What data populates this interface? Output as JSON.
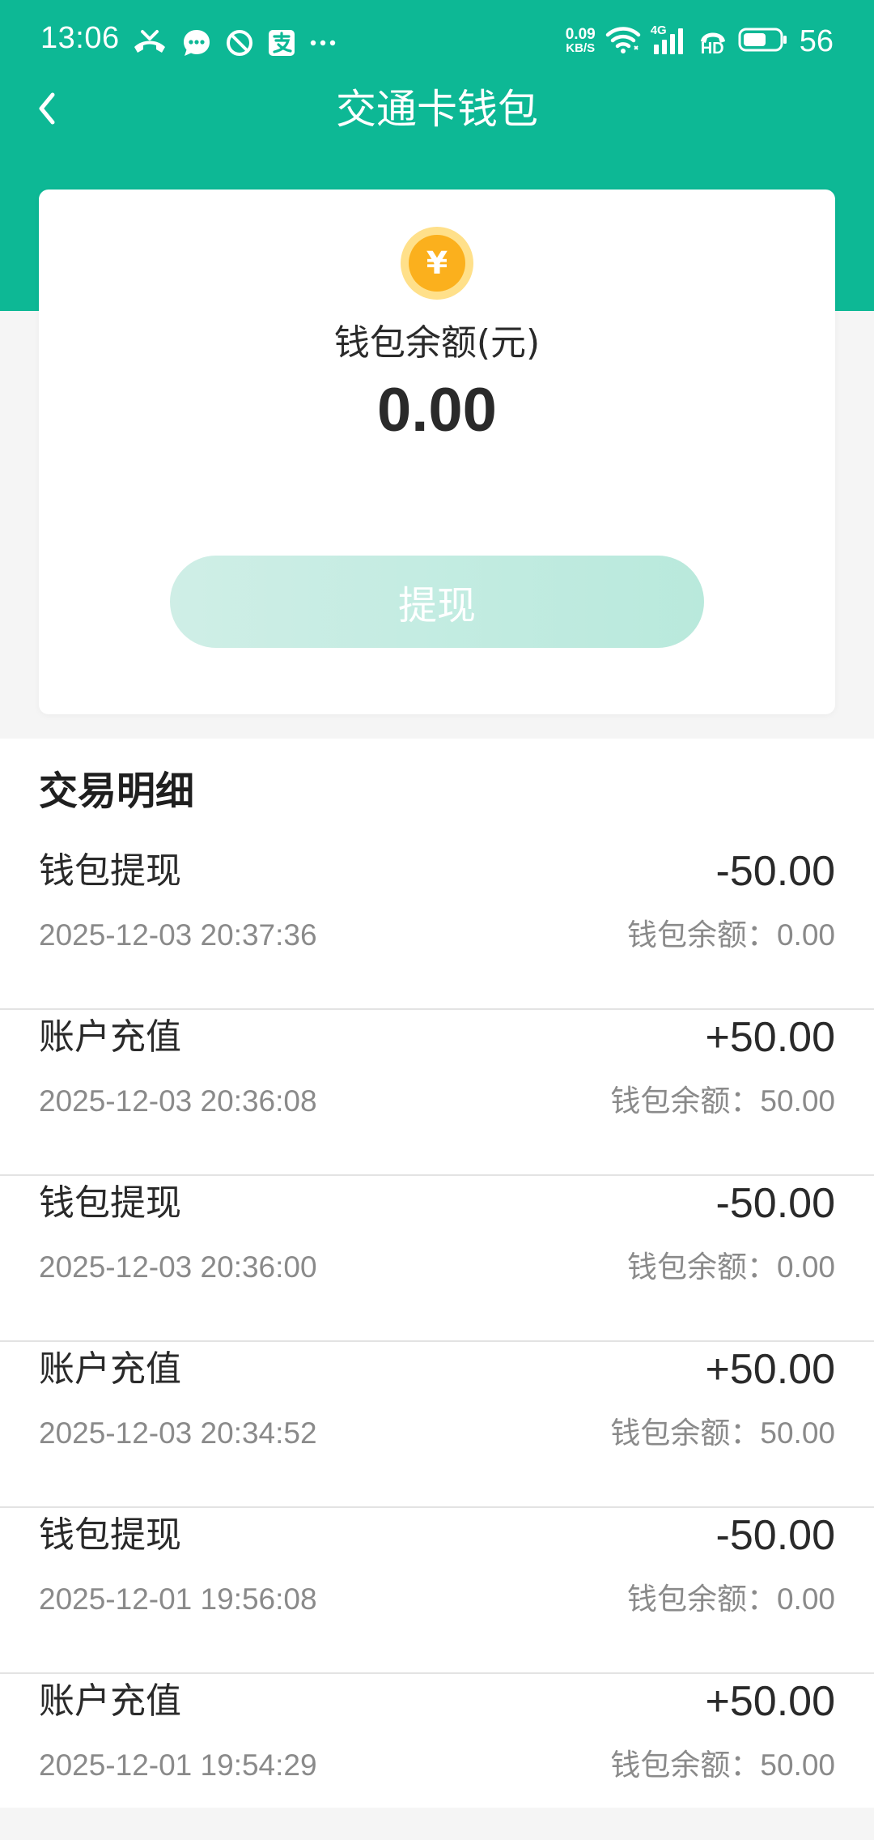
{
  "status_bar": {
    "time": "13:06",
    "net_speed_value": "0.09",
    "net_speed_unit": "KB/S",
    "network_type": "4G",
    "hd_label": "HD",
    "battery_level": "56",
    "icons": [
      "missed-call-icon",
      "message-bubble-icon",
      "do-not-disturb-icon",
      "alipay-icon",
      "more-dots-icon",
      "wifi-icon",
      "signal-icon",
      "hd-call-icon",
      "battery-icon"
    ],
    "color": "#ffffff"
  },
  "header": {
    "title": "交通卡钱包",
    "back_icon": "chevron-left-icon",
    "background_color": "#0db895"
  },
  "wallet": {
    "balance_label": "钱包余额(元)",
    "balance_value": "0.00",
    "coin_symbol": "¥",
    "withdraw_label": "提现"
  },
  "transactions": {
    "title": "交易明细",
    "balance_prefix": "钱包余额：",
    "items": [
      {
        "title": "钱包提现",
        "time": "2025-12-03 20:37:36",
        "amount": "-50.00",
        "balance": "0.00"
      },
      {
        "title": "账户充值",
        "time": "2025-12-03 20:36:08",
        "amount": "+50.00",
        "balance": "50.00"
      },
      {
        "title": "钱包提现",
        "time": "2025-12-03 20:36:00",
        "amount": "-50.00",
        "balance": "0.00"
      },
      {
        "title": "账户充值",
        "time": "2025-12-03 20:34:52",
        "amount": "+50.00",
        "balance": "50.00"
      },
      {
        "title": "钱包提现",
        "time": "2025-12-01 19:56:08",
        "amount": "-50.00",
        "balance": "0.00"
      },
      {
        "title": "账户充值",
        "time": "2025-12-01 19:54:29",
        "amount": "+50.00",
        "balance": "50.00"
      }
    ]
  }
}
